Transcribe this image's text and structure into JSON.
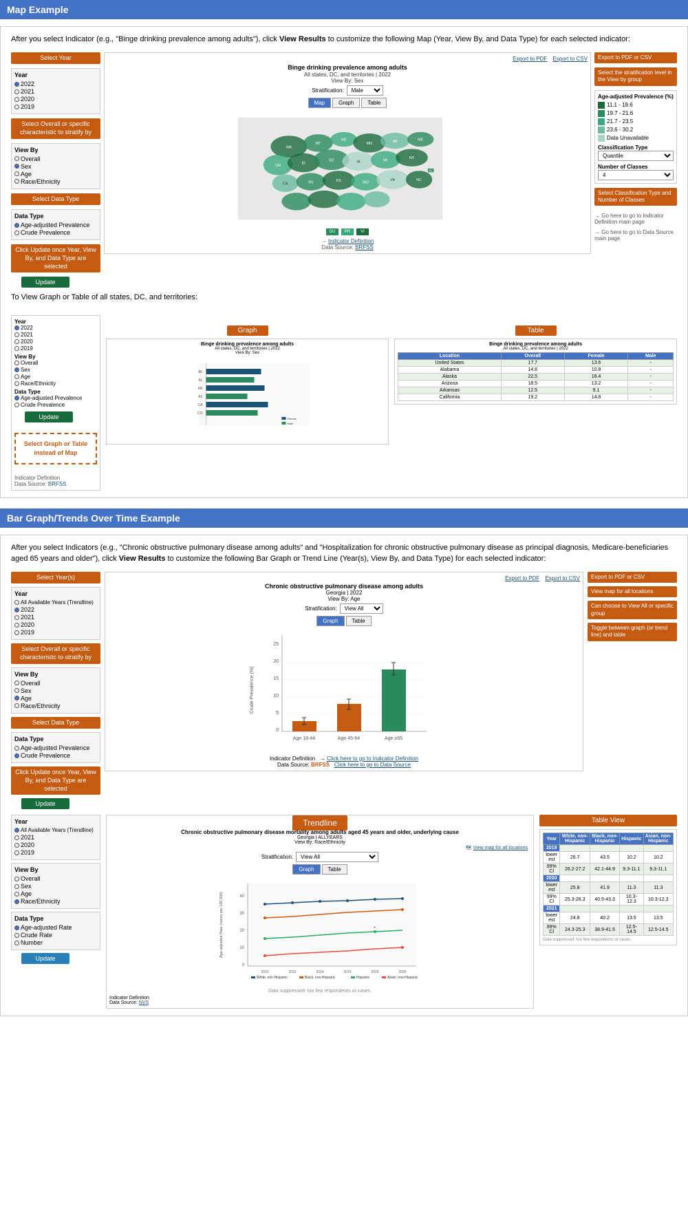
{
  "sections": {
    "map_section": {
      "header": "Map Example",
      "intro": "After you select Indicator (e.g., \"Binge drinking prevalence among adults\"), click View Results to customize the following Map (Year, View By, and Data Type) for each selected indicator:",
      "intro_bold": "View Results",
      "map_title": "Binge drinking prevalence among adults",
      "map_subtitle1": "All states, DC, and territories | 2022",
      "map_subtitle2": "View By: Sex",
      "stratification_label": "Stratification:",
      "stratification_value": "Male",
      "view_tabs": [
        "Map",
        "Graph",
        "Table"
      ],
      "active_tab": "Map",
      "export_pdf": "Export to PDF",
      "export_csv": "Export to CSV",
      "year_label": "Year",
      "years": [
        "2022",
        "2021",
        "2020",
        "2019"
      ],
      "selected_year": "2022",
      "view_by_label": "View By",
      "view_by_options": [
        "Overall",
        "Sex",
        "Age",
        "Race/Ethnicity"
      ],
      "selected_view_by": "Sex",
      "data_type_label": "Data Type",
      "data_type_options": [
        "Age-adjusted Prevalence",
        "Crude Prevalence"
      ],
      "selected_data_type": "Age-adjusted Prevalence",
      "update_btn": "Update",
      "orange_labels": {
        "select_year": "Select Year",
        "select_overall": "Select Overall or specific characteristic to stratify by",
        "select_data_type": "Select Data Type",
        "click_update": "Click Update once Year, View By, and Data Type are selected",
        "export_pdf_csv": "Export to PDF or CSV",
        "stratification": "Select the stratification level in the View by group",
        "classification": "Select Classification Type and Number of Classes"
      },
      "legend_title": "Age-adjusted Prevalence (%)",
      "legend_items": [
        {
          "color": "#1a6b3c",
          "label": "11.1 - 19.6"
        },
        {
          "color": "#2a8a5c",
          "label": "19.7 - 21.6"
        },
        {
          "color": "#3aaa7c",
          "label": "21.7 - 23.5"
        },
        {
          "color": "#6abba0",
          "label": "23.6 - 30.2"
        },
        {
          "color": "#aad4c8",
          "label": "Data Unavailable"
        }
      ],
      "classification_type_label": "Classification Type",
      "classification_type_value": "Quantile",
      "num_classes_label": "Number of Classes",
      "num_classes_value": "4",
      "indicator_definition": "Indicator Definition",
      "data_source": "BRFSS",
      "footer_indicator": "Go here to go to Indicator Definition main page",
      "footer_source": "Go here to go to Data Source main page",
      "to_view_text": "To View Graph or Table of all states, DC, and territories:",
      "select_graph_table": "Select Graph or Table instead of Map",
      "graph_label": "Graph",
      "table_label": "Table"
    },
    "bar_section": {
      "header": "Bar Graph/Trends Over Time Example",
      "intro": "After you select Indicators (e.g., \"Chronic obstructive pulmonary disease among adults\" and \"Hospitalization for chronic obstructive pulmonary disease as principal diagnosis, Medicare-beneficiaries aged 65 years and older\"), click View Results to customize the following Bar Graph or Trend Line (Year(s), View By, and Data Type) for each selected indicator:",
      "intro_bold": "View Results",
      "chart_title": "Chronic obstructive pulmonary disease among adults",
      "chart_subtitle1": "Georgia | 2022",
      "chart_subtitle2": "View By: Age",
      "stratification_label": "Stratification:",
      "stratification_value": "View All",
      "view_tabs": [
        "Graph",
        "Table"
      ],
      "active_tab": "Graph",
      "y_axis_label": "Crude Prevalence (%)",
      "x_axis_labels": [
        "Age 18-44",
        "Age 45-64",
        "Age ≥65"
      ],
      "bar_values": [
        3,
        8,
        18
      ],
      "bar_colors": [
        "#C55A11",
        "#C55A11",
        "#2a8a5c"
      ],
      "export_pdf": "Export to PDF",
      "export_csv": "Export to CSV",
      "view_map_label": "View map for all locations",
      "year_label": "Year",
      "years": [
        "All Available Years (Trendline)",
        "2022",
        "2021",
        "2020",
        "2019"
      ],
      "selected_year": "2022",
      "view_by_label": "View By",
      "view_by_options": [
        "Overall",
        "Sex",
        "Age",
        "Race/Ethnicity"
      ],
      "selected_view_by": "Age",
      "data_type_label": "Data Type",
      "data_type_options": [
        "Age-adjusted Prevalence",
        "Crude Prevalence"
      ],
      "selected_data_type": "Crude Prevalence",
      "update_btn": "Update",
      "orange_labels": {
        "select_years": "Select Year(s)",
        "select_overall": "Select Overall or specific characteristic to stratify by",
        "select_data_type": "Select Data Type",
        "click_update": "Click Update once Year, View By, and Data Type are selected",
        "export": "Export to PDF or CSV",
        "view_map": "View map for all locations",
        "view_all": "Can choose to View All or specific group",
        "toggle": "Toggle between graph (or trend line) and table"
      },
      "indicator_definition_label": "Indicator Definition",
      "data_source_label": "BRFSS",
      "click_indicator": "Click here to go to Indicator Definition",
      "click_source": "Click here to go to Data Source",
      "trendline_label": "Trendline",
      "trendline_title": "Chronic obstructive pulmonary disease mortality among adults aged 45 years and older, underlying cause",
      "trendline_subtitle1": "Georgia | ALLYEARS",
      "trendline_subtitle2": "View By: Race/Ethnicity",
      "trendline_stratification": "Stratification:",
      "trendline_strat_value": "View All",
      "trendline_view_tabs": [
        "Graph",
        "Table"
      ],
      "trendline_year_label": "Year",
      "trendline_years": [
        "All Available Years (Trendline)",
        "2021",
        "2020",
        "2019"
      ],
      "trendline_view_by_label": "View By",
      "trendline_view_by_options": [
        "Overall",
        "Sex",
        "Age",
        "Race/Ethnicity"
      ],
      "trendline_selected_view_by": "Race/Ethnicity",
      "trendline_data_type_label": "Data Type",
      "trendline_data_type_options": [
        "Age-adjusted Rate",
        "Crude Rate",
        "Number"
      ],
      "trendline_selected_data_type": "Age-adjusted Rate",
      "trendline_update_btn": "Update",
      "trendline_y_label": "Age-adjusted Rate (cases per 100,000)",
      "trendline_legend": [
        "White, non-Hispanic",
        "Black, non-Hispanic",
        "Hispanic",
        "Asian, non-Hispanic"
      ],
      "trendline_legend_colors": [
        "#1a5276",
        "#C55A11",
        "#2ecc71",
        "#e74c3c"
      ],
      "table_view_label": "Table View",
      "indicator_footer_label": "Indicator Definition",
      "source_footer": "NVS",
      "data_suppressed_note": "Data suppressed: too few respondents or cases."
    }
  }
}
